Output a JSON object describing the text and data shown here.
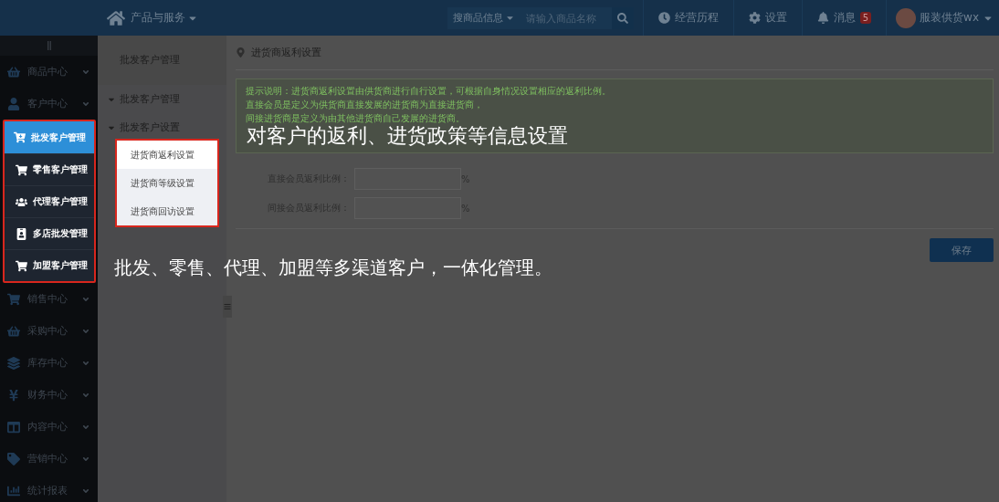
{
  "topbar": {
    "menu": "产品与服务",
    "search": {
      "scope": "搜商品信息",
      "placeholder": "请输入商品名称"
    },
    "links": [
      {
        "kind": "history",
        "label": "经营历程"
      },
      {
        "kind": "settings",
        "label": "设置"
      },
      {
        "kind": "messages",
        "label": "消息",
        "badge": "5"
      }
    ],
    "user": "服装供货wx"
  },
  "sidebar": {
    "items": [
      {
        "kind": "goods",
        "label": "商品中心"
      },
      {
        "kind": "customer",
        "label": "客户中心",
        "children": [
          {
            "kind": "wholesale",
            "label": "批发客户管理",
            "selected": true
          },
          {
            "kind": "cart",
            "label": "零售客户管理",
            "selected": false
          },
          {
            "kind": "agent",
            "label": "代理客户管理",
            "selected": false
          },
          {
            "kind": "store",
            "label": "多店批发管理",
            "selected": false
          },
          {
            "kind": "cart",
            "label": "加盟客户管理",
            "selected": false
          }
        ]
      },
      {
        "kind": "sales",
        "label": "销售中心"
      },
      {
        "kind": "purchase",
        "label": "采购中心"
      },
      {
        "kind": "stock",
        "label": "库存中心"
      },
      {
        "kind": "finance",
        "label": "财务中心"
      },
      {
        "kind": "content",
        "label": "内容中心"
      },
      {
        "kind": "marketing",
        "label": "营销中心"
      },
      {
        "kind": "report",
        "label": "统计报表"
      }
    ]
  },
  "subnav": {
    "title": "批发客户管理",
    "sections": [
      {
        "label": "批发客户管理",
        "expanded": true
      },
      {
        "label": "批发客户设置",
        "expanded": true
      }
    ],
    "popup": [
      {
        "label": "进货商返利设置",
        "selected": true
      },
      {
        "label": "进货商等级设置",
        "selected": false
      },
      {
        "label": "进货商回访设置",
        "selected": false
      }
    ]
  },
  "main": {
    "breadcrumb": "进货商返利设置",
    "hint": [
      "提示说明：进货商返利设置由供货商进行自行设置，可根据自身情况设置相应的返利比例。",
      "直接会员是定义为供货商直接发展的进货商为直接进货商，",
      "间接进货商是定义为由其他进货商自己发展的进货商。"
    ],
    "fields": [
      {
        "label": "直接会员返利比例：",
        "unit": "%"
      },
      {
        "label": "间接会员返利比例：",
        "unit": "%"
      }
    ],
    "save": "保存"
  },
  "annotations": [
    "对客户的返利、进货政策等信息设置",
    "批发、零售、代理、加盟等多渠道客户，一体化管理。"
  ]
}
